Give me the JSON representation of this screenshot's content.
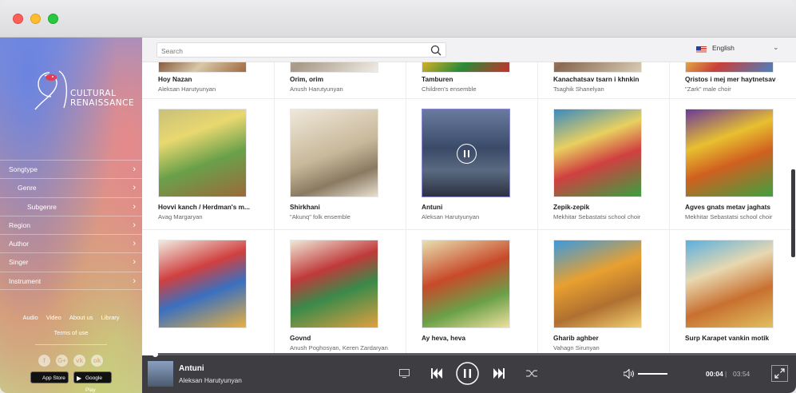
{
  "window": {
    "controls": [
      "close",
      "minimize",
      "maximize"
    ]
  },
  "sidebar": {
    "logo_text_line1": "CULTURAL",
    "logo_text_line2": "RENAISSANCE",
    "menu": [
      {
        "label": "Songtype"
      },
      {
        "label": "Genre"
      },
      {
        "label": "Subgenre"
      },
      {
        "label": "Region"
      },
      {
        "label": "Author"
      },
      {
        "label": "Singer"
      },
      {
        "label": "Instrument"
      }
    ],
    "links": [
      "Audio",
      "Video",
      "About us",
      "Library"
    ],
    "terms": "Terms of use",
    "socials": [
      "facebook-icon",
      "google-plus-icon",
      "vk-icon",
      "odnoklassniki-icon"
    ],
    "store_badges": {
      "app_store": "App Store",
      "google_play": "Google Play"
    }
  },
  "header": {
    "search_placeholder": "Search",
    "language": "English"
  },
  "grid": [
    {
      "title": "Hoy Nazan",
      "artist": "Aleksan Harutyunyan"
    },
    {
      "title": "Orim, orim",
      "artist": "Anush Harutyunyan"
    },
    {
      "title": "Tamburen",
      "artist": "Children's ensemble"
    },
    {
      "title": "Kanachatsav tsarn i khnkin",
      "artist": "Tsaghik Shanelyan"
    },
    {
      "title": "Qristos i mej mer haytnetsav",
      "artist": "\"Zark\" male choir"
    },
    {
      "title": "Hovvi kanch / Herdman's m...",
      "artist": "Avag Margaryan"
    },
    {
      "title": "Shirkhani",
      "artist": "\"Akunq\" folk ensemble"
    },
    {
      "title": "Antuni",
      "artist": "Aleksan Harutyunyan",
      "playing": true
    },
    {
      "title": "Zepik-zepik",
      "artist": "Mekhitar Sebastatsi school choir"
    },
    {
      "title": "Agves gnats metav jaghats",
      "artist": "Mekhitar Sebastatsi school choir"
    },
    {
      "title": "",
      "artist": ""
    },
    {
      "title": "Govnd",
      "artist": "Anush Poghosyan, Keren Zardaryan"
    },
    {
      "title": "Ay heva, heva",
      "artist": ""
    },
    {
      "title": "Gharib aghber",
      "artist": "Vahagn Sirunyan"
    },
    {
      "title": "Surp Karapet vankin motik",
      "artist": ""
    }
  ],
  "player": {
    "title": "Antuni",
    "artist": "Aleksan Harutyunyan",
    "time_current": "00:04",
    "time_separator": "|",
    "time_total": "03:54",
    "progress": 0.02
  },
  "colors": {
    "player_bg": "#3d3d42",
    "accent": "#ffffff"
  }
}
